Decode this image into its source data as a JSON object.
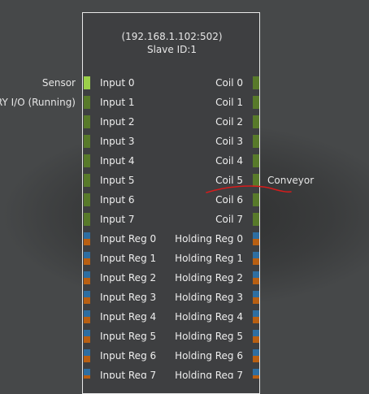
{
  "header": {
    "address": "(192.168.1.102:502)",
    "slave_id": "Slave ID:1"
  },
  "external_labels": {
    "left": [
      "Sensor",
      "DRY I/O (Running)"
    ],
    "right": [
      "Conveyor"
    ]
  },
  "rows": [
    {
      "left": "Input 0",
      "right": "Coil 0"
    },
    {
      "left": "Input 1",
      "right": "Coil 1"
    },
    {
      "left": "Input 2",
      "right": "Coil 2"
    },
    {
      "left": "Input 3",
      "right": "Coil 3"
    },
    {
      "left": "Input 4",
      "right": "Coil 4"
    },
    {
      "left": "Input 5",
      "right": "Coil 5"
    },
    {
      "left": "Input 6",
      "right": "Coil 6"
    },
    {
      "left": "Input 7",
      "right": "Coil 7"
    },
    {
      "left": "Input Reg 0",
      "right": "Holding Reg 0"
    },
    {
      "left": "Input Reg 1",
      "right": "Holding Reg 1"
    },
    {
      "left": "Input Reg 2",
      "right": "Holding Reg 2"
    },
    {
      "left": "Input Reg 3",
      "right": "Holding Reg 3"
    },
    {
      "left": "Input Reg 4",
      "right": "Holding Reg 4"
    },
    {
      "left": "Input Reg 5",
      "right": "Holding Reg 5"
    },
    {
      "left": "Input Reg 6",
      "right": "Holding Reg 6"
    },
    {
      "left": "Input Reg 7",
      "right": "Holding Reg 7"
    }
  ],
  "colors": {
    "digital_port": "#587a2a",
    "active_port": "#9bd04a",
    "register_top": "#2e6ea1",
    "register_bottom": "#b85f12",
    "annotation_stroke": "#d81b1b"
  }
}
